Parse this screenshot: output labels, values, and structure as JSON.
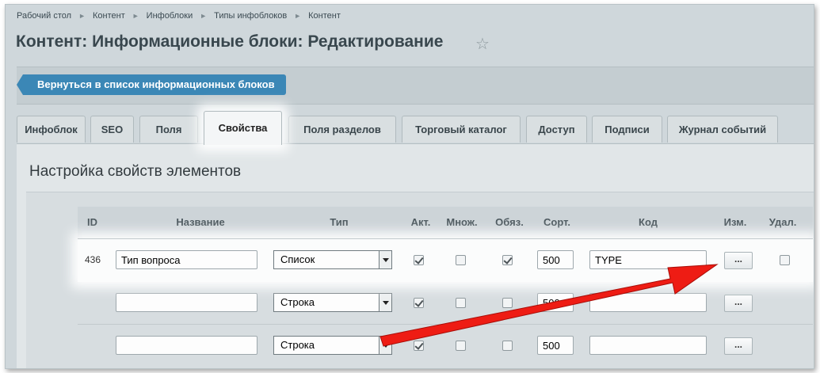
{
  "breadcrumb": [
    "Рабочий стол",
    "Контент",
    "Инфоблоки",
    "Типы инфоблоков",
    "Контент"
  ],
  "page_title": "Контент: Информационные блоки: Редактирование",
  "back_button": "Вернуться в список информационных блоков",
  "tabs": [
    {
      "label": "Инфоблок"
    },
    {
      "label": "SEO"
    },
    {
      "label": "Поля"
    },
    {
      "label": "Свойства",
      "active": true
    },
    {
      "label": "Поля разделов"
    },
    {
      "label": "Торговый каталог"
    },
    {
      "label": "Доступ"
    },
    {
      "label": "Подписи"
    },
    {
      "label": "Журнал событий"
    }
  ],
  "section_title": "Настройка свойств элементов",
  "table": {
    "headers": {
      "id": "ID",
      "name": "Название",
      "type": "Тип",
      "active": "Акт.",
      "multiple": "Множ.",
      "required": "Обяз.",
      "sort": "Сорт.",
      "code": "Код",
      "edit": "Изм.",
      "delete": "Удал."
    },
    "rows": [
      {
        "id": "436",
        "name": "Тип вопроса",
        "type": "Список",
        "active": true,
        "multiple": false,
        "required": true,
        "sort": "500",
        "code": "TYPE",
        "edit": "...",
        "highlighted": true
      },
      {
        "id": "",
        "name": "",
        "type": "Строка",
        "active": true,
        "multiple": false,
        "required": false,
        "sort": "500",
        "code": "",
        "edit": "..."
      },
      {
        "id": "",
        "name": "",
        "type": "Строка",
        "active": true,
        "multiple": false,
        "required": false,
        "sort": "500",
        "code": "",
        "edit": "..."
      }
    ]
  },
  "annotation_color": "#ee1c14"
}
